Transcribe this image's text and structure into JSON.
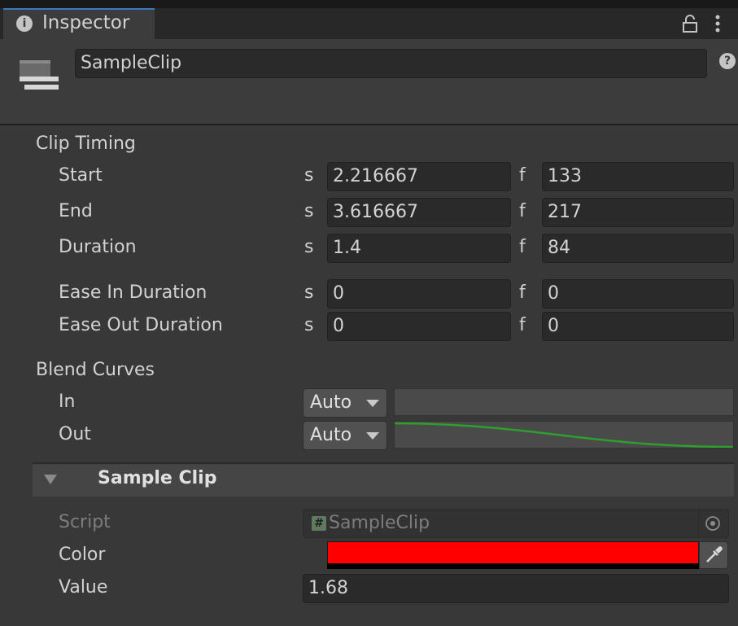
{
  "window": {
    "tab_title": "Inspector",
    "tab_icon": "info-icon",
    "lock_icon": "lock-icon",
    "menu_icon": "kebab-menu-icon"
  },
  "header": {
    "asset_name": "SampleClip",
    "asset_icon": "timeline-clip-icon",
    "help_icon": "help-icon"
  },
  "clip_timing": {
    "title": "Clip Timing",
    "rows": [
      {
        "label": "Start",
        "s_unit": "s",
        "s_value": "2.216667",
        "f_unit": "f",
        "f_value": "133"
      },
      {
        "label": "End",
        "s_unit": "s",
        "s_value": "3.616667",
        "f_unit": "f",
        "f_value": "217"
      },
      {
        "label": "Duration",
        "s_unit": "s",
        "s_value": "1.4",
        "f_unit": "f",
        "f_value": "84"
      },
      {
        "label": "Ease In Duration",
        "s_unit": "s",
        "s_value": "0",
        "f_unit": "f",
        "f_value": "0"
      },
      {
        "label": "Ease Out Duration",
        "s_unit": "s",
        "s_value": "0",
        "f_unit": "f",
        "f_value": "0"
      }
    ]
  },
  "blend_curves": {
    "title": "Blend Curves",
    "in": {
      "label": "In",
      "mode": "Auto"
    },
    "out": {
      "label": "Out",
      "mode": "Auto",
      "curve_color": "#2e9e2e"
    }
  },
  "sample_clip": {
    "title": "Sample Clip",
    "script": {
      "label": "Script",
      "value": "SampleClip"
    },
    "color": {
      "label": "Color",
      "value": "#ff0000"
    },
    "value": {
      "label": "Value",
      "value": "1.68"
    }
  },
  "colors": {
    "accent": "#3a79bb",
    "background": "#383838",
    "field": "#2a2a2a"
  }
}
